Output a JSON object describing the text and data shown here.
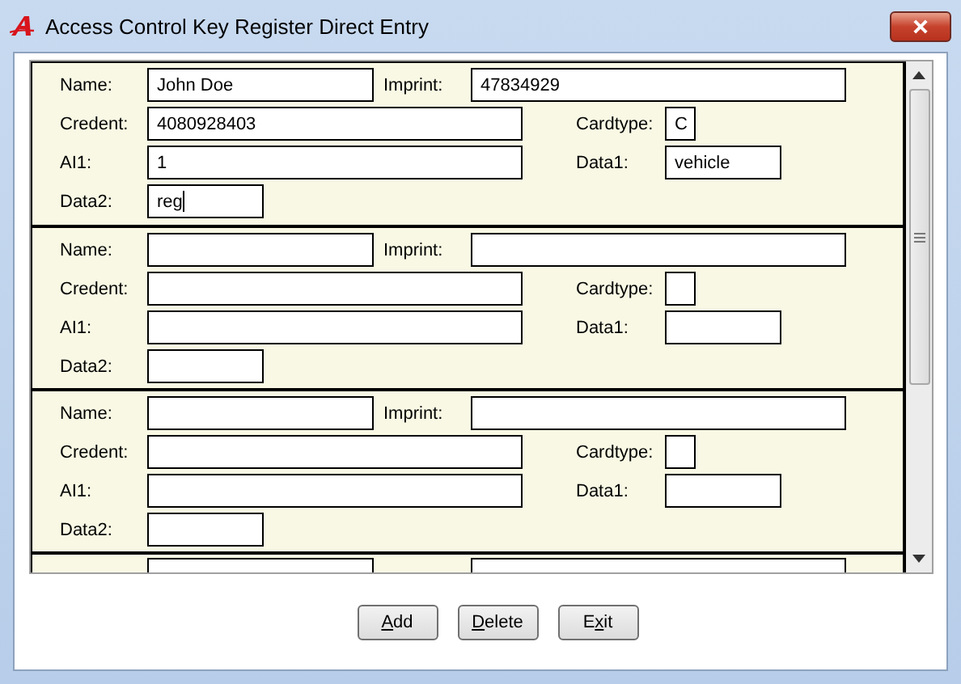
{
  "window": {
    "title": "Access Control Key Register Direct Entry"
  },
  "records": [
    {
      "rows": [
        [
          {
            "kind": "name",
            "label": "Name:",
            "value": "John Doe",
            "focused": false
          },
          {
            "kind": "imprint",
            "label": "Imprint:",
            "value": "47834929",
            "focused": false
          }
        ],
        [
          {
            "kind": "credent",
            "label": "Credent:",
            "value": "4080928403",
            "focused": false
          },
          {
            "kind": "cardtype",
            "label": "Cardtype:",
            "value": "C",
            "focused": false
          }
        ],
        [
          {
            "kind": "ai1",
            "label": "AI1:",
            "value": "1",
            "focused": false
          },
          {
            "kind": "data1",
            "label": "Data1:",
            "value": "vehicle",
            "focused": false
          }
        ],
        [
          {
            "kind": "data2",
            "label": "Data2:",
            "value": "reg",
            "focused": true
          }
        ]
      ]
    },
    {
      "rows": [
        [
          {
            "kind": "name",
            "label": "Name:",
            "focused": false
          },
          {
            "kind": "imprint",
            "label": "Imprint:",
            "focused": false
          }
        ],
        [
          {
            "kind": "credent",
            "label": "Credent:",
            "focused": false
          },
          {
            "kind": "cardtype",
            "label": "Cardtype:",
            "focused": false
          }
        ],
        [
          {
            "kind": "ai1",
            "label": "AI1:",
            "focused": false
          },
          {
            "kind": "data1",
            "label": "Data1:",
            "focused": false
          }
        ],
        [
          {
            "kind": "data2",
            "label": "Data2:",
            "focused": false
          }
        ]
      ]
    },
    {
      "rows": [
        [
          {
            "kind": "name",
            "label": "Name:",
            "focused": false
          },
          {
            "kind": "imprint",
            "label": "Imprint:",
            "focused": false
          }
        ],
        [
          {
            "kind": "credent",
            "label": "Credent:",
            "focused": false
          },
          {
            "kind": "cardtype",
            "label": "Cardtype:",
            "focused": false
          }
        ],
        [
          {
            "kind": "ai1",
            "label": "AI1:",
            "focused": false
          },
          {
            "kind": "data1",
            "label": "Data1:",
            "focused": false
          }
        ],
        [
          {
            "kind": "data2",
            "label": "Data2:",
            "focused": false
          }
        ]
      ]
    }
  ],
  "buttons": [
    {
      "key": "A",
      "after": "dd"
    },
    {
      "key": "D",
      "after": "elete"
    },
    {
      "before": "E",
      "key": "x",
      "after": "it"
    }
  ]
}
